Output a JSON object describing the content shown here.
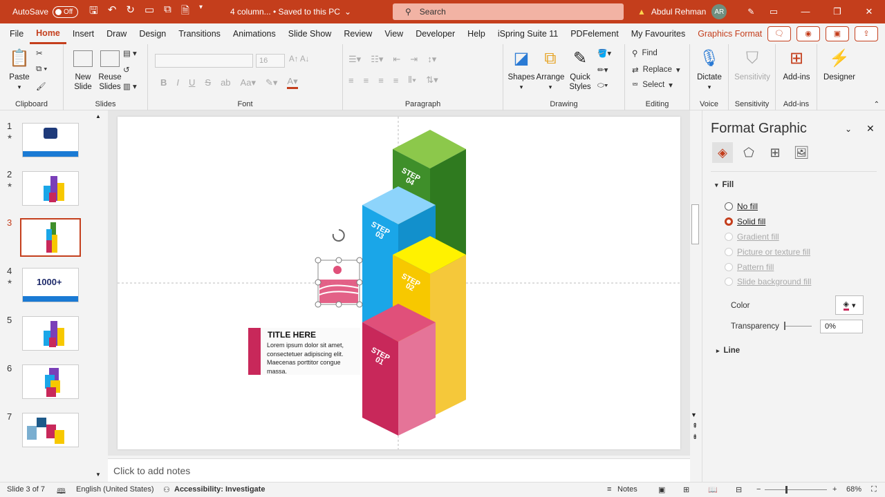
{
  "titlebar": {
    "autosave_label": "AutoSave",
    "autosave_state": "Off",
    "doc_name": "4 column... • Saved to this PC",
    "search_placeholder": "Search",
    "user_name": "Abdul Rehman",
    "user_initials": "AR"
  },
  "menu": {
    "items": [
      "File",
      "Home",
      "Insert",
      "Draw",
      "Design",
      "Transitions",
      "Animations",
      "Slide Show",
      "Review",
      "View",
      "Developer",
      "Help",
      "iSpring Suite 11",
      "PDFelement",
      "My Favourites",
      "Graphics Format"
    ],
    "active": "Home"
  },
  "ribbon": {
    "clipboard": {
      "paste": "Paste",
      "label": "Clipboard"
    },
    "slides": {
      "new_slide": "New Slide",
      "reuse_slides": "Reuse Slides",
      "label": "Slides"
    },
    "font": {
      "size": "16",
      "label": "Font"
    },
    "paragraph": {
      "label": "Paragraph"
    },
    "drawing": {
      "shapes": "Shapes",
      "arrange": "Arrange",
      "quick_styles": "Quick Styles",
      "label": "Drawing"
    },
    "editing": {
      "find": "Find",
      "replace": "Replace",
      "select": "Select",
      "label": "Editing"
    },
    "voice": {
      "dictate": "Dictate",
      "label": "Voice"
    },
    "sensitivity": {
      "button": "Sensitivity",
      "label": "Sensitivity"
    },
    "addins": {
      "button": "Add-ins",
      "label": "Add-ins"
    },
    "designer": {
      "button": "Designer"
    }
  },
  "thumbnails": [
    {
      "num": "1",
      "star": "★"
    },
    {
      "num": "2",
      "star": "★"
    },
    {
      "num": "3",
      "star": ""
    },
    {
      "num": "4",
      "star": "★"
    },
    {
      "num": "5",
      "star": ""
    },
    {
      "num": "6",
      "star": ""
    },
    {
      "num": "7",
      "star": ""
    }
  ],
  "slide": {
    "steps": [
      "STEP\n04",
      "STEP\n03",
      "STEP\n02",
      "STEP\n01"
    ],
    "step_labels": [
      "STEP",
      "04",
      "STEP",
      "03",
      "STEP",
      "02",
      "STEP",
      "01"
    ],
    "card_title": "TITLE HERE",
    "card_body": "Lorem ipsum dolor sit amet, consectetuer adipiscing elit. Maecenas porttitor congue massa."
  },
  "notes_placeholder": "Click to add notes",
  "format_pane": {
    "title": "Format Graphic",
    "section_fill": "Fill",
    "options": [
      "No fill",
      "Solid fill",
      "Gradient fill",
      "Picture or texture fill",
      "Pattern fill",
      "Slide background fill"
    ],
    "selected": "Solid fill",
    "color_label": "Color",
    "transparency_label": "Transparency",
    "transparency_value": "0%",
    "section_line": "Line"
  },
  "status": {
    "slide_of": "Slide 3 of 7",
    "language": "English (United States)",
    "accessibility": "Accessibility: Investigate",
    "notes": "Notes",
    "zoom": "68%"
  },
  "colors": {
    "accent": "#c43e1c",
    "green": "#3f8f2a",
    "blue": "#1aa6e8",
    "yellow": "#f7c800",
    "pink": "#c8285a"
  }
}
